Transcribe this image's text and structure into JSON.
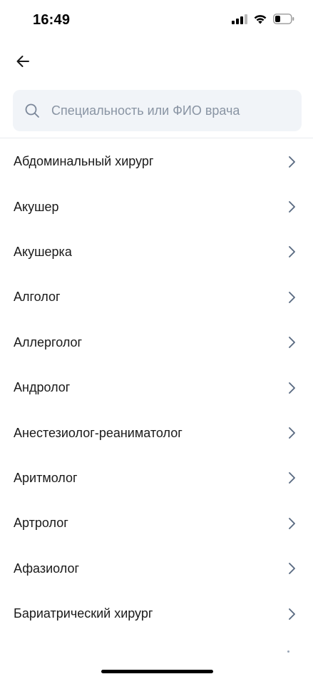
{
  "status_bar": {
    "time": "16:49"
  },
  "nav": {
    "back_icon": "arrow-left-icon"
  },
  "search": {
    "placeholder": "Специальность или ФИО врача",
    "value": "",
    "icon": "search-icon"
  },
  "specialties": [
    {
      "label": "Абдоминальный хирург"
    },
    {
      "label": "Акушер"
    },
    {
      "label": "Акушерка"
    },
    {
      "label": "Алголог"
    },
    {
      "label": "Аллерголог"
    },
    {
      "label": "Андролог"
    },
    {
      "label": "Анестезиолог-реаниматолог"
    },
    {
      "label": "Аритмолог"
    },
    {
      "label": "Артролог"
    },
    {
      "label": "Афазиолог"
    },
    {
      "label": "Бариатрический хирург"
    }
  ],
  "colors": {
    "accent": "#5a6b82",
    "search_bg": "#f1f4f8",
    "placeholder": "#8994a3",
    "text": "#1a1a1a"
  }
}
